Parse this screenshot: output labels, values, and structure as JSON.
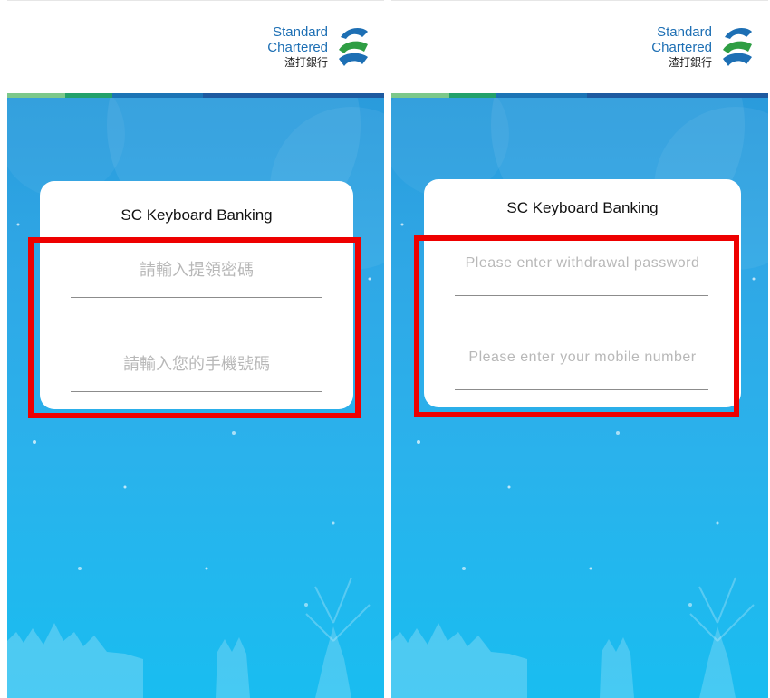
{
  "brand": {
    "line1": "Standard",
    "line2": "Chartered",
    "line3": "渣打銀行",
    "icon": "standard-chartered-logo-icon",
    "blue": "#1d6fb4",
    "green": "#2f9e44"
  },
  "accent_colors": [
    "#7cc88a",
    "#23a16a",
    "#1b74b5",
    "#1e5aa0"
  ],
  "highlight_color": "#ee0000",
  "screens": [
    {
      "title": "SC Keyboard Banking",
      "password_placeholder": "請輸入提領密碼",
      "mobile_placeholder": "請輸入您的手機號碼"
    },
    {
      "title": "SC Keyboard Banking",
      "password_placeholder": "Please enter withdrawal password",
      "mobile_placeholder": "Please enter your mobile number"
    }
  ]
}
